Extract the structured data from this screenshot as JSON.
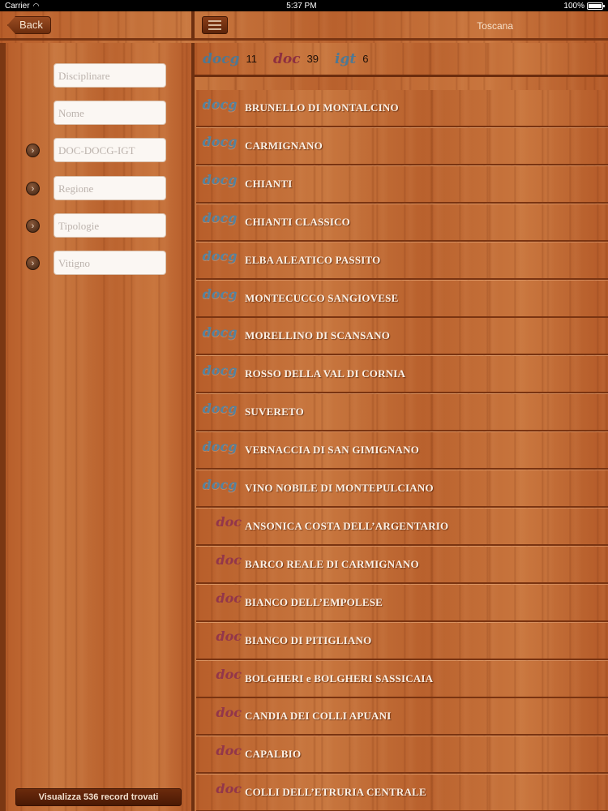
{
  "status": {
    "carrier": "Carrier",
    "time": "5:37 PM",
    "battery": "100%"
  },
  "nav": {
    "back": "Back",
    "title": "Toscana"
  },
  "filters": [
    {
      "placeholder": "Disciplinare",
      "chevron": false
    },
    {
      "placeholder": "Nome",
      "chevron": false
    },
    {
      "placeholder": "DOC-DOCG-IGT",
      "chevron": true
    },
    {
      "placeholder": "Regione",
      "chevron": true
    },
    {
      "placeholder": "Tipologie",
      "chevron": true
    },
    {
      "placeholder": "Vitigno",
      "chevron": true
    }
  ],
  "record_button": "Visualizza 536 record trovati",
  "counts": [
    {
      "tag": "docg",
      "count": "11"
    },
    {
      "tag": "doc",
      "count": "39"
    },
    {
      "tag": "igt",
      "count": "6"
    }
  ],
  "wines": [
    {
      "type": "docg",
      "name": "BRUNELLO DI MONTALCINO"
    },
    {
      "type": "docg",
      "name": "CARMIGNANO"
    },
    {
      "type": "docg",
      "name": "CHIANTI"
    },
    {
      "type": "docg",
      "name": "CHIANTI CLASSICO"
    },
    {
      "type": "docg",
      "name": "ELBA ALEATICO PASSITO"
    },
    {
      "type": "docg",
      "name": "MONTECUCCO SANGIOVESE"
    },
    {
      "type": "docg",
      "name": "MORELLINO DI SCANSANO"
    },
    {
      "type": "docg",
      "name": "ROSSO DELLA VAL DI CORNIA"
    },
    {
      "type": "docg",
      "name": "SUVERETO"
    },
    {
      "type": "docg",
      "name": "VERNACCIA DI SAN GIMIGNANO"
    },
    {
      "type": "docg",
      "name": "VINO NOBILE DI MONTEPULCIANO"
    },
    {
      "type": "doc",
      "name": "ANSONICA COSTA DELL’ARGENTARIO"
    },
    {
      "type": "doc",
      "name": "BARCO REALE DI CARMIGNANO"
    },
    {
      "type": "doc",
      "name": "BIANCO DELL’EMPOLESE"
    },
    {
      "type": "doc",
      "name": "BIANCO DI PITIGLIANO"
    },
    {
      "type": "doc",
      "name": "BOLGHERI e BOLGHERI SASSICAIA"
    },
    {
      "type": "doc",
      "name": "CANDIA DEI COLLI APUANI"
    },
    {
      "type": "doc",
      "name": "CAPALBIO"
    },
    {
      "type": "doc",
      "name": "COLLI DELL’ETRURIA CENTRALE"
    }
  ]
}
